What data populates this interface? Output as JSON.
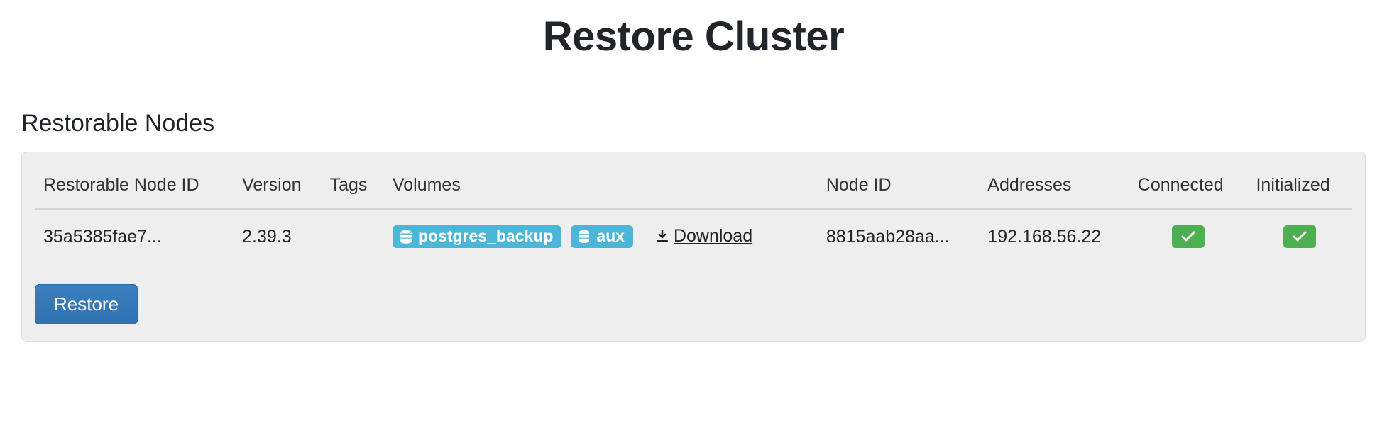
{
  "page": {
    "title": "Restore Cluster",
    "section_title": "Restorable Nodes"
  },
  "table": {
    "headers": {
      "restorable_node_id": "Restorable Node ID",
      "version": "Version",
      "tags": "Tags",
      "volumes": "Volumes",
      "node_id": "Node ID",
      "addresses": "Addresses",
      "connected": "Connected",
      "initialized": "Initialized"
    },
    "rows": [
      {
        "restorable_node_id": "35a5385fae7...",
        "version": "2.39.3",
        "tags": "",
        "volumes": [
          "postgres_backup",
          "aux"
        ],
        "download_label": " Download",
        "node_id": "8815aab28aa...",
        "addresses": "192.168.56.22",
        "connected": true,
        "initialized": true
      }
    ]
  },
  "actions": {
    "restore_label": "Restore"
  },
  "icons": {
    "database": "database-icon",
    "download": "download-icon",
    "check": "check-icon"
  }
}
